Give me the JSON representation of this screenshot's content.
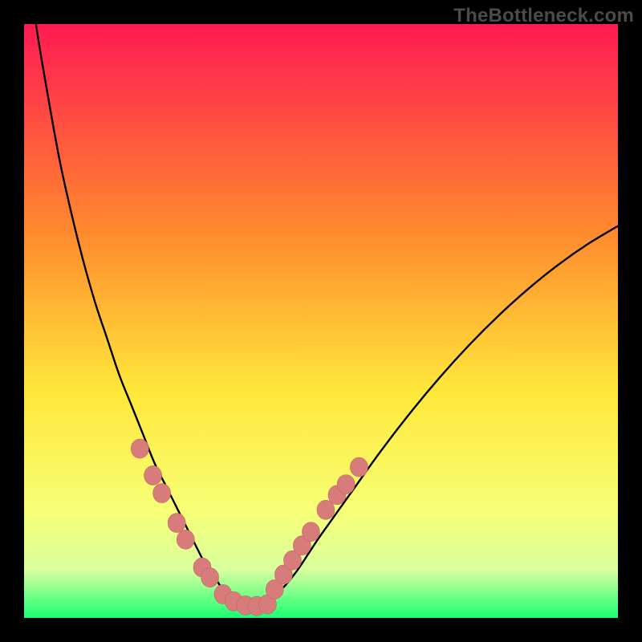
{
  "watermark": "TheBottleneck.com",
  "colors": {
    "frame_bg": "#000000",
    "curve_stroke": "#000000",
    "bead_fill": "#d87b7b",
    "bead_stroke": "#c26666",
    "grad_top": "#ff1a52",
    "grad_mid_upper": "#ff8a2e",
    "grad_mid": "#ffe83a",
    "grad_low1": "#f7ff76",
    "grad_low2": "#d8ff9e",
    "grad_bottom": "#1aff73"
  },
  "chart_data": {
    "type": "line",
    "title": "",
    "xlabel": "",
    "ylabel": "",
    "xlim": [
      0,
      100
    ],
    "ylim": [
      0,
      100
    ],
    "x": [
      0,
      2,
      4,
      6,
      8,
      10,
      12,
      14,
      16,
      18,
      20,
      22,
      24,
      26,
      28,
      30,
      31,
      32,
      34,
      36,
      38,
      40,
      42,
      44,
      46,
      48,
      50,
      55,
      60,
      65,
      70,
      75,
      80,
      85,
      90,
      95,
      100
    ],
    "series": [
      {
        "name": "bottleneck-curve",
        "values": [
          115,
          100,
          88,
          77,
          68,
          60,
          53,
          47,
          41,
          36,
          31,
          26,
          22,
          18,
          14,
          10,
          8,
          7,
          4,
          2.5,
          2,
          2.2,
          3.5,
          5.5,
          8,
          11,
          14,
          21,
          28,
          34.5,
          40.5,
          46,
          51,
          55.5,
          59.5,
          63,
          66
        ]
      }
    ],
    "annotations": {
      "beads_left": [
        {
          "x": 19.5,
          "y": 28.5
        },
        {
          "x": 21.7,
          "y": 24.0
        },
        {
          "x": 23.2,
          "y": 21.0
        },
        {
          "x": 25.7,
          "y": 16.0
        },
        {
          "x": 27.2,
          "y": 13.2
        },
        {
          "x": 30.0,
          "y": 8.5
        },
        {
          "x": 31.3,
          "y": 6.8
        }
      ],
      "beads_bottom": [
        {
          "x": 33.5,
          "y": 4.0
        },
        {
          "x": 35.3,
          "y": 2.8
        },
        {
          "x": 37.3,
          "y": 2.1
        },
        {
          "x": 39.2,
          "y": 2.0
        },
        {
          "x": 41.0,
          "y": 2.3
        }
      ],
      "beads_right": [
        {
          "x": 42.2,
          "y": 4.8
        },
        {
          "x": 43.7,
          "y": 7.3
        },
        {
          "x": 45.2,
          "y": 9.7
        },
        {
          "x": 46.8,
          "y": 12.2
        },
        {
          "x": 48.3,
          "y": 14.5
        },
        {
          "x": 50.8,
          "y": 18.2
        },
        {
          "x": 52.7,
          "y": 20.7
        },
        {
          "x": 54.2,
          "y": 22.5
        },
        {
          "x": 56.4,
          "y": 25.4
        }
      ]
    }
  }
}
